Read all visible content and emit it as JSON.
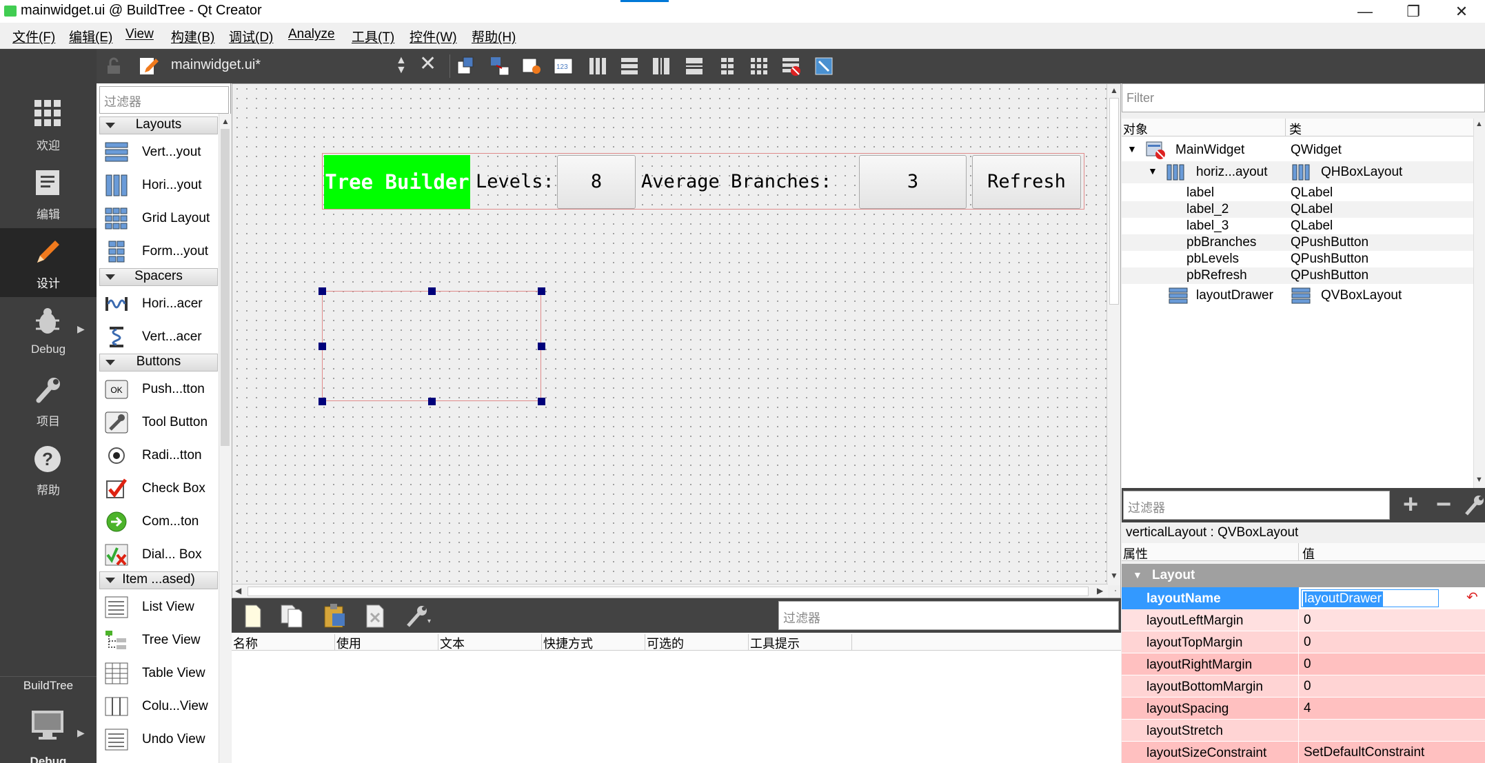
{
  "window": {
    "title": "mainwidget.ui @ BuildTree - Qt Creator",
    "minimize": "—",
    "restore": "❐",
    "close": "✕"
  },
  "menu": [
    "文件(F)",
    "编辑(E)",
    "View",
    "构建(B)",
    "调试(D)",
    "Analyze",
    "工具(T)",
    "控件(W)",
    "帮助(H)"
  ],
  "modes": [
    {
      "label": "欢迎",
      "icon": "grid-icon"
    },
    {
      "label": "编辑",
      "icon": "document-icon"
    },
    {
      "label": "设计",
      "icon": "pencil-icon"
    },
    {
      "label": "Debug",
      "icon": "bug-icon"
    },
    {
      "label": "项目",
      "icon": "wrench-icon"
    },
    {
      "label": "帮助",
      "icon": "help-icon"
    }
  ],
  "project": {
    "label": "BuildTree",
    "cut": "Debug"
  },
  "doc": {
    "filename": "mainwidget.ui*"
  },
  "widgetbox": {
    "filter_placeholder": "过滤器",
    "categories": [
      "Layouts",
      "Spacers",
      "Buttons",
      "Item ...ased)"
    ],
    "items": [
      "Vert...yout",
      "Hori...yout",
      "Grid Layout",
      "Form...yout",
      "Hori...acer",
      "Vert...acer",
      "Push...tton",
      "Tool Button",
      "Radi...tton",
      "Check Box",
      "Com...ton",
      "Dial... Box",
      "List View",
      "Tree View",
      "Table View",
      "Colu...View",
      "Undo View"
    ]
  },
  "form": {
    "title_label": "Tree Builder",
    "levels_label": "Levels:",
    "levels_value": "8",
    "branches_label": "Average Branches:",
    "branches_value": "3",
    "refresh": "Refresh",
    "accent": "#00ff00"
  },
  "actions": {
    "filter_placeholder": "过滤器",
    "columns": [
      "名称",
      "使用",
      "文本",
      "快捷方式",
      "可选的",
      "工具提示"
    ]
  },
  "objects": {
    "filter_placeholder": "Filter",
    "columns": [
      "对象",
      "类"
    ],
    "rows": [
      {
        "name": "MainWidget",
        "cls": "QWidget"
      },
      {
        "name": "horiz...ayout",
        "cls": "QHBoxLayout"
      },
      {
        "name": "label",
        "cls": "QLabel"
      },
      {
        "name": "label_2",
        "cls": "QLabel"
      },
      {
        "name": "label_3",
        "cls": "QLabel"
      },
      {
        "name": "pbBranches",
        "cls": "QPushButton"
      },
      {
        "name": "pbLevels",
        "cls": "QPushButton"
      },
      {
        "name": "pbRefresh",
        "cls": "QPushButton"
      },
      {
        "name": "layoutDrawer",
        "cls": "QVBoxLayout"
      }
    ]
  },
  "properties": {
    "filter_placeholder": "过滤器",
    "class_line": "verticalLayout : QVBoxLayout",
    "columns": [
      "属性",
      "值"
    ],
    "group": "Layout",
    "rows": [
      {
        "name": "layoutName",
        "value": "layoutDrawer"
      },
      {
        "name": "layoutLeftMargin",
        "value": "0"
      },
      {
        "name": "layoutTopMargin",
        "value": "0"
      },
      {
        "name": "layoutRightMargin",
        "value": "0"
      },
      {
        "name": "layoutBottomMargin",
        "value": "0"
      },
      {
        "name": "layoutSpacing",
        "value": "4"
      },
      {
        "name": "layoutStretch",
        "value": ""
      },
      {
        "name": "layoutSizeConstraint",
        "value": "SetDefaultConstraint"
      }
    ]
  }
}
